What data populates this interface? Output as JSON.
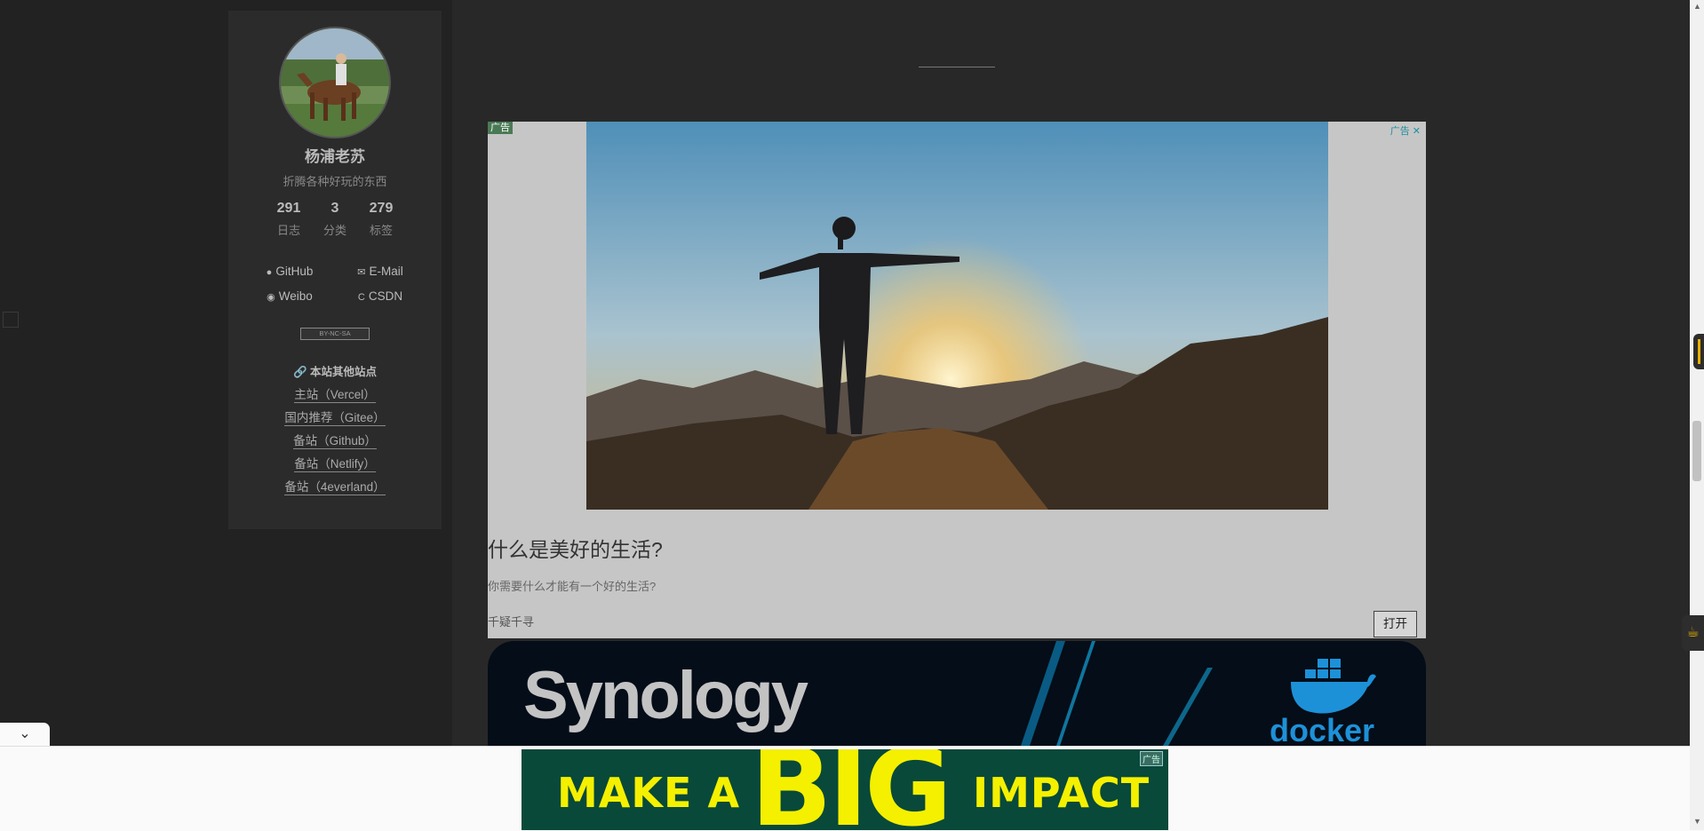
{
  "reading_progress": 0.445,
  "author": {
    "name": "杨浦老苏",
    "description": "折腾各种好玩的东西"
  },
  "stats": [
    {
      "count": "291",
      "label": "日志"
    },
    {
      "count": "3",
      "label": "分类"
    },
    {
      "count": "279",
      "label": "标签"
    }
  ],
  "social_links": [
    {
      "label": "GitHub",
      "icon": "github-icon"
    },
    {
      "label": "E-Mail",
      "icon": "envelope-icon"
    },
    {
      "label": "Weibo",
      "icon": "weibo-icon"
    },
    {
      "label": "CSDN",
      "icon": "csdn-icon"
    }
  ],
  "license_badge": "BY-NC-SA",
  "sites": {
    "title": "本站其他站点",
    "items": [
      {
        "label": "主站（Vercel）"
      },
      {
        "label": "国内推荐（Gitee）"
      },
      {
        "label": "备站（Github）"
      },
      {
        "label": "备站（Netlify）"
      },
      {
        "label": "备站（4everland）"
      }
    ]
  },
  "ad1": {
    "label": "广告",
    "corner_label": "广告",
    "title": "什么是美好的生活?",
    "description": "你需要什么才能有一个好的生活?",
    "source": "千疑千寻",
    "open_button": "打开"
  },
  "ad2": {
    "brand": "Synology",
    "docker_text": "docker"
  },
  "bottom_ad": {
    "text_left": "MAKE A",
    "text_big": "BIG",
    "text_right": "IMPACT",
    "ad_mark": "广告"
  },
  "colors": {
    "progress": "#2fa595",
    "banner_bg": "#08493a",
    "banner_text": "#f4f000"
  }
}
